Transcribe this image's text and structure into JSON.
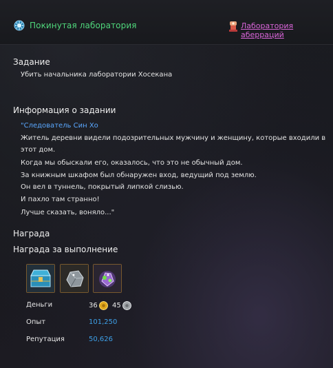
{
  "header": {
    "quest_title": "Покинутая лаборатория",
    "location_link": "Лаборатория аберраций",
    "quest_icon": "blue-gear-icon",
    "location_icon": "location-marker-icon"
  },
  "task": {
    "heading": "Задание",
    "objective": "Убить начальника лаборатории Хосекана"
  },
  "info": {
    "heading": "Информация о задании",
    "npc_prefix": "\"",
    "npc_name": "Следователь Син Хо",
    "lines": [
      "Житель деревни видели подозрительных мужчину и женщину, которые входили в",
      "этот дом.",
      "Когда мы обыскали его, оказалось, что это не обычный дом.",
      "За книжным шкафом был обнаружен вход, ведущий под землю.",
      "Он вел в туннель, покрытый липкой слизью.",
      "И пахло там странно!",
      "Лучше сказать, воняло...\""
    ]
  },
  "reward": {
    "heading": "Награда",
    "completion_heading": "Награда за выполнение",
    "items": [
      {
        "name": "blue-chest-icon"
      },
      {
        "name": "silver-ore-icon"
      },
      {
        "name": "green-crystal-icon"
      }
    ],
    "money_label": "Деньги",
    "money_gold": "36",
    "money_silver": "45",
    "exp_label": "Опыт",
    "exp_value": "101,250",
    "rep_label": "Репутация",
    "rep_value": "50,626"
  },
  "colors": {
    "quest_title": "#4fd67b",
    "location_link": "#d965d9",
    "npc_name": "#5aa8ff",
    "reward_value": "#3ea0e8"
  }
}
